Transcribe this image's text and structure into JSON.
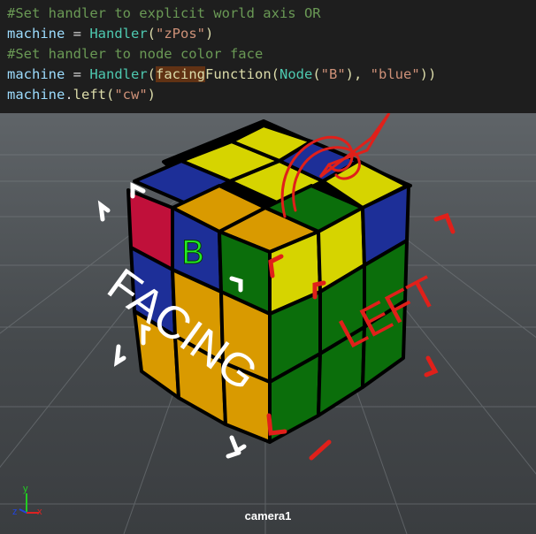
{
  "code": {
    "line1": "#Set handler to explicit world axis OR",
    "line2": {
      "var": "machine",
      "op": " = ",
      "fn": "Handler",
      "open": "(",
      "str": "\"zPos\"",
      "close": ")"
    },
    "line3": "#Set handler to node color face",
    "line4": {
      "var": "machine",
      "op": " = ",
      "fn": "Handler",
      "open": "(",
      "hl": "facing",
      "fn2": "Function",
      "open2": "(",
      "fn3": "Node",
      "open3": "(",
      "str1": "\"B\"",
      "sep1": "), ",
      "str2": "\"blue\"",
      "close": "))"
    },
    "line5": {
      "var": "machine",
      "dot": ".",
      "meth": "left",
      "open": "(",
      "str": "\"cw\"",
      "close": ")"
    }
  },
  "viewport": {
    "camera_label": "camera1",
    "face_label": "B",
    "annotation_facing": "FACING",
    "annotation_left": "LEFT",
    "axis_y": "y",
    "axis_x": "x",
    "axis_z": "z",
    "colors": {
      "yellow": "#d6d400",
      "orange": "#d99a00",
      "green": "#0b6e0b",
      "blue": "#1d2f98",
      "red": "#c0103a",
      "annotation_red": "#e0201a"
    }
  }
}
